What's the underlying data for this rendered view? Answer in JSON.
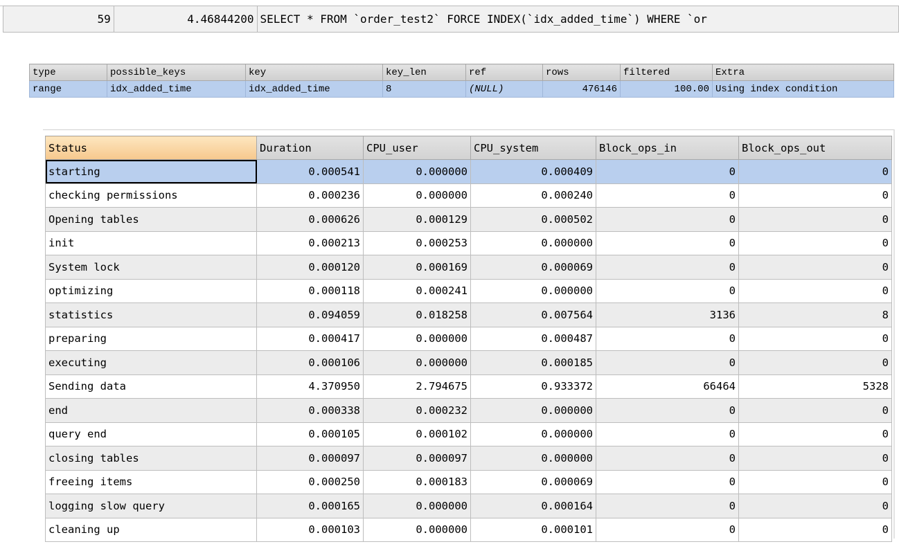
{
  "query_row": {
    "query_id": "59",
    "duration": "4.46844200",
    "query": "SELECT * FROM `order_test2` FORCE INDEX(`idx_added_time`) WHERE `or"
  },
  "explain": {
    "headers": [
      "type",
      "possible_keys",
      "key",
      "key_len",
      "ref",
      "rows",
      "filtered",
      "Extra"
    ],
    "row": [
      "range",
      "idx_added_time",
      "idx_added_time",
      "8",
      "(NULL)",
      "476146",
      "100.00",
      "Using index condition"
    ]
  },
  "profile": {
    "headers": [
      "Status",
      "Duration",
      "CPU_user",
      "CPU_system",
      "Block_ops_in",
      "Block_ops_out"
    ],
    "rows": [
      [
        "starting",
        "0.000541",
        "0.000000",
        "0.000409",
        "0",
        "0"
      ],
      [
        "checking permissions",
        "0.000236",
        "0.000000",
        "0.000240",
        "0",
        "0"
      ],
      [
        "Opening tables",
        "0.000626",
        "0.000129",
        "0.000502",
        "0",
        "0"
      ],
      [
        "init",
        "0.000213",
        "0.000253",
        "0.000000",
        "0",
        "0"
      ],
      [
        "System lock",
        "0.000120",
        "0.000169",
        "0.000069",
        "0",
        "0"
      ],
      [
        "optimizing",
        "0.000118",
        "0.000241",
        "0.000000",
        "0",
        "0"
      ],
      [
        "statistics",
        "0.094059",
        "0.018258",
        "0.007564",
        "3136",
        "8"
      ],
      [
        "preparing",
        "0.000417",
        "0.000000",
        "0.000487",
        "0",
        "0"
      ],
      [
        "executing",
        "0.000106",
        "0.000000",
        "0.000185",
        "0",
        "0"
      ],
      [
        "Sending data",
        "4.370950",
        "2.794675",
        "0.933372",
        "66464",
        "5328"
      ],
      [
        "end",
        "0.000338",
        "0.000232",
        "0.000000",
        "0",
        "0"
      ],
      [
        "query end",
        "0.000105",
        "0.000102",
        "0.000000",
        "0",
        "0"
      ],
      [
        "closing tables",
        "0.000097",
        "0.000097",
        "0.000000",
        "0",
        "0"
      ],
      [
        "freeing items",
        "0.000250",
        "0.000183",
        "0.000069",
        "0",
        "0"
      ],
      [
        "logging slow query",
        "0.000165",
        "0.000000",
        "0.000164",
        "0",
        "0"
      ],
      [
        "cleaning up",
        "0.000103",
        "0.000000",
        "0.000101",
        "0",
        "0"
      ]
    ]
  },
  "colors": {
    "selection": "#b9cfee",
    "sorted_header": "#f6c88d",
    "alt_row": "#ececec"
  }
}
